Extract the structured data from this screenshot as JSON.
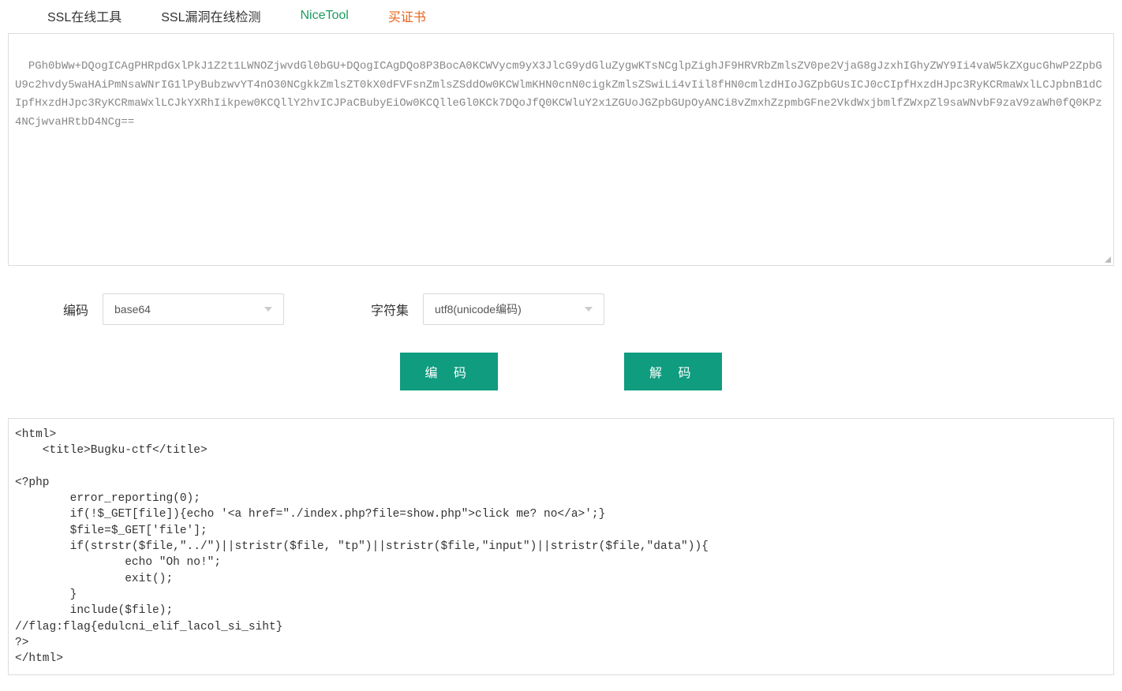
{
  "nav": {
    "item1": "SSL在线工具",
    "item2": "SSL漏洞在线检测",
    "item3": "NiceTool",
    "item4": "买证书"
  },
  "inputText": "PGh0bWw+DQogICAgPHRpdGxlPkJ1Z2t1LWNOZjwvdGl0bGU+DQogICAgDQo8P3BocA0KCWVycm9yX3JlcG9ydGluZygwKTsNCglpZighJF9HRVRbZmlsZV0pe2VjaG8gJzxhIGhyZWY9Ii4vaW5kZXgucGhwP2ZpbGU9c2hvdy5waHAiPmNsaWNrIG1lPyBubzwvYT4nO30NCgkkZmlsZT0kX0dFVFsnZmlsZSddOw0KCWlmKHN0cnN0cigkZmlsZSwiLi4vIil8fHN0cmlzdHIoJGZpbGUsICJ0cCIpfHxzdHJpc3RyKCRmaWxlLCJpbnB1dCIpfHxzdHJpc3RyKCRmaWxlLCJkYXRhIikpew0KCQllY2hvICJPaCBubyEiOw0KCQlleGl0KCk7DQoJfQ0KCWluY2x1ZGUoJGZpbGUpOyANCi8vZmxhZzpmbGFne2VkdWxjbmlfZWxpZl9saWNvbF9zaV9zaWh0fQ0KPz4NCjwvaHRtbD4NCg==",
  "controls": {
    "encodingLabel": "编码",
    "encodingValue": "base64",
    "charsetLabel": "字符集",
    "charsetValue": "utf8(unicode编码)"
  },
  "buttons": {
    "encode": "编 码",
    "decode": "解 码"
  },
  "outputText": "<html>\n    <title>Bugku-ctf</title>\n    \n<?php\n\terror_reporting(0);\n\tif(!$_GET[file]){echo '<a href=\"./index.php?file=show.php\">click me? no</a>';}\n\t$file=$_GET['file'];\n\tif(strstr($file,\"../\")||stristr($file, \"tp\")||stristr($file,\"input\")||stristr($file,\"data\")){\n\t\techo \"Oh no!\";\n\t\texit();\n\t}\n\tinclude($file); \n//flag:flag{edulcni_elif_lacol_si_siht}\n?>\n</html>"
}
